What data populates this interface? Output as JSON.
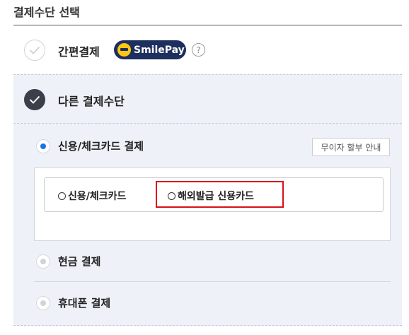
{
  "section": {
    "title": "결제수단 선택"
  },
  "simple_pay": {
    "label": "간편결제",
    "badge_text": "SmilePay",
    "help": "?",
    "selected": false
  },
  "other_methods": {
    "label": "다른 결제수단",
    "selected": true,
    "credit_card": {
      "label": "신용/체크카드 결제",
      "selected": true,
      "installment_button": "무이자 할부 안내",
      "options": [
        {
          "label": "신용/체크카드",
          "selected": false
        },
        {
          "label": "해외발급 신용카드",
          "selected": false,
          "highlighted": true
        }
      ]
    },
    "cash": {
      "label": "현금 결제",
      "selected": false
    },
    "mobile": {
      "label": "휴대폰 결제",
      "selected": false
    }
  },
  "colors": {
    "brand_navy": "#1d2f5e",
    "smile_yellow": "#ffc712",
    "highlight_red": "#d9101a",
    "radio_blue": "#1a73e8"
  }
}
